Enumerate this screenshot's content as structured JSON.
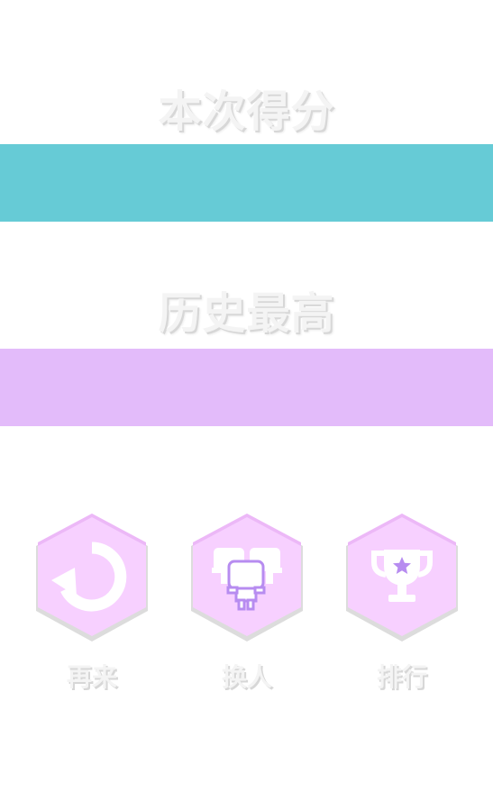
{
  "score": {
    "current_title": "本次得分",
    "current_value": "",
    "best_title": "历史最高",
    "best_value": ""
  },
  "actions": [
    {
      "id": "retry",
      "label": "再来",
      "icon": "retry-icon"
    },
    {
      "id": "switch",
      "label": "换人",
      "icon": "switch-character-icon"
    },
    {
      "id": "rank",
      "label": "排行",
      "icon": "trophy-icon"
    }
  ],
  "colors": {
    "current_band": "#66cbd6",
    "best_band": "#e3bbfa",
    "hex_fill": "#f7d0ff",
    "hex_edge": "#e8e8e8",
    "icon_accent": "#b78cf0"
  }
}
